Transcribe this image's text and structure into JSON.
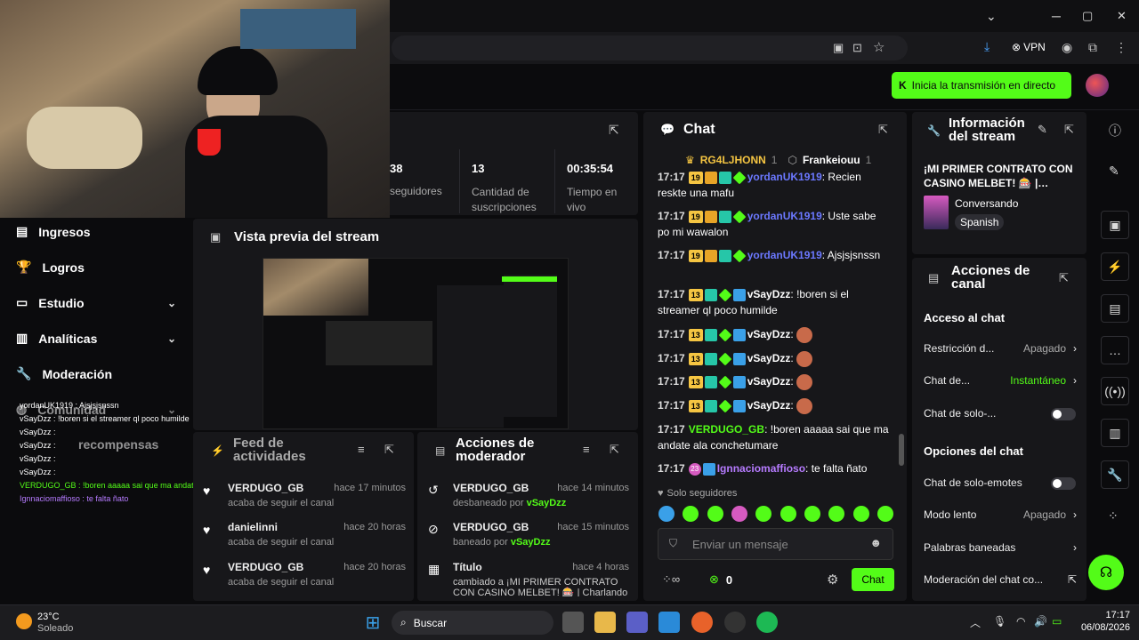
{
  "window": {
    "minimize": "─",
    "maximize": "▢",
    "close": "✕",
    "chevron": "⌄"
  },
  "browser": {
    "vpn_label": "VPN"
  },
  "header": {
    "go_live_label": "Inicia la transmisión en directo"
  },
  "stats": [
    {
      "value": "38",
      "label": "seguidores"
    },
    {
      "value": "13",
      "label": "Cantidad de suscripciones"
    },
    {
      "value": "00:35:54",
      "label": "Tiempo en vivo"
    }
  ],
  "sidebar": {
    "items": [
      {
        "label": "Ingresos"
      },
      {
        "label": "Logros"
      },
      {
        "label": "Estudio"
      },
      {
        "label": "Analíticas"
      },
      {
        "label": "Moderación"
      },
      {
        "label": "Comunidad"
      },
      {
        "label": "recompensas"
      }
    ]
  },
  "preview": {
    "title": "Vista previa del stream"
  },
  "activity": {
    "title": "Feed de actividades",
    "items": [
      {
        "name": "VERDUGO_GB",
        "sub": "acaba de seguir el canal",
        "time": "hace 17 minutos"
      },
      {
        "name": "danielinni",
        "sub": "acaba de seguir el canal",
        "time": "hace 20 horas"
      },
      {
        "name": "VERDUGO_GB",
        "sub": "acaba de seguir el canal",
        "time": "hace 20 horas"
      }
    ]
  },
  "modactions": {
    "title": "Acciones de moderador",
    "items": [
      {
        "name": "VERDUGO_GB",
        "action": "desbaneado por",
        "by": "vSayDzz",
        "time": "hace 14 minutos"
      },
      {
        "name": "VERDUGO_GB",
        "action": "baneado por",
        "by": "vSayDzz",
        "time": "hace 15 minutos"
      },
      {
        "name": "Título",
        "action": "cambiado a ¡MI PRIMER CONTRATO CON CASINO MELBET! 🎰 | Charlando",
        "by": "",
        "time": "hace 4 horas"
      }
    ]
  },
  "chat": {
    "title": "Chat",
    "pinned": [
      {
        "name": "RG4LJHONN",
        "count": "1"
      },
      {
        "name": "Frankeiouu",
        "count": "1"
      }
    ],
    "messages": [
      {
        "time": "17:17",
        "user": "yordanUK1919",
        "text": "Recien reskte una mafu"
      },
      {
        "time": "17:17",
        "user": "yordanUK1919",
        "text": "Uste sabe po mi wawalon"
      },
      {
        "time": "17:17",
        "user": "yordanUK1919",
        "text": "Ajsjsjsnssn"
      },
      {
        "time": "17:17",
        "user": "vSayDzz",
        "text": "!boren si el streamer ql poco humilde"
      },
      {
        "time": "17:17",
        "user": "vSayDzz",
        "text": ""
      },
      {
        "time": "17:17",
        "user": "vSayDzz",
        "text": ""
      },
      {
        "time": "17:17",
        "user": "vSayDzz",
        "text": ""
      },
      {
        "time": "17:17",
        "user": "vSayDzz",
        "text": ""
      },
      {
        "time": "17:17",
        "user": "VERDUGO_GB",
        "text": "!boren aaaaa sai que ma andate ala conchetumare"
      },
      {
        "time": "17:17",
        "user": "Ignnaciomaffioso",
        "text": "te falta ñato"
      }
    ],
    "followers_only": "Solo seguidores",
    "input_placeholder": "Enviar un mensaje",
    "points": "0",
    "send_label": "Chat",
    "badge_19": "19",
    "badge_13": "13",
    "badge_23": "23"
  },
  "stream_info": {
    "title": "Información del stream",
    "stream_title": "¡MI PRIMER CONTRATO CON CASINO MELBET! 🎰 |…",
    "category": "Conversando",
    "language": "Spanish"
  },
  "channel_actions": {
    "title": "Acciones de canal",
    "section_access": "Acceso al chat",
    "restriction_label": "Restricción d...",
    "restriction_value": "Apagado",
    "chat_de_label": "Chat de...",
    "chat_de_value": "Instantáneo",
    "chat_solo_label": "Chat de solo-...",
    "section_options": "Opciones del chat",
    "emotes_label": "Chat de solo-emotes",
    "slow_label": "Modo lento",
    "slow_value": "Apagado",
    "banned_words_label": "Palabras baneadas",
    "mod_label": "Moderación del chat co..."
  },
  "taskbar": {
    "weather_temp": "23°C",
    "weather_desc": "Soleado",
    "search_label": "Buscar",
    "time": "17:17",
    "date": "06/08/2026"
  },
  "overlay": {
    "lines": [
      "yordanUK1919 : Ajsjsjsnssn",
      "vSayDzz : !boren si el streamer ql poco humilde",
      "vSayDzz :",
      "vSayDzz :",
      "vSayDzz :",
      "vSayDzz :",
      "VERDUGO_GB : !boren aaaaa sai que ma andate ala conchetumare",
      "Ignnaciomaffioso : te falta ñato"
    ]
  },
  "colors": {
    "accent": "#53fc18",
    "panel": "#17171a",
    "bg": "#0b0b0d"
  }
}
